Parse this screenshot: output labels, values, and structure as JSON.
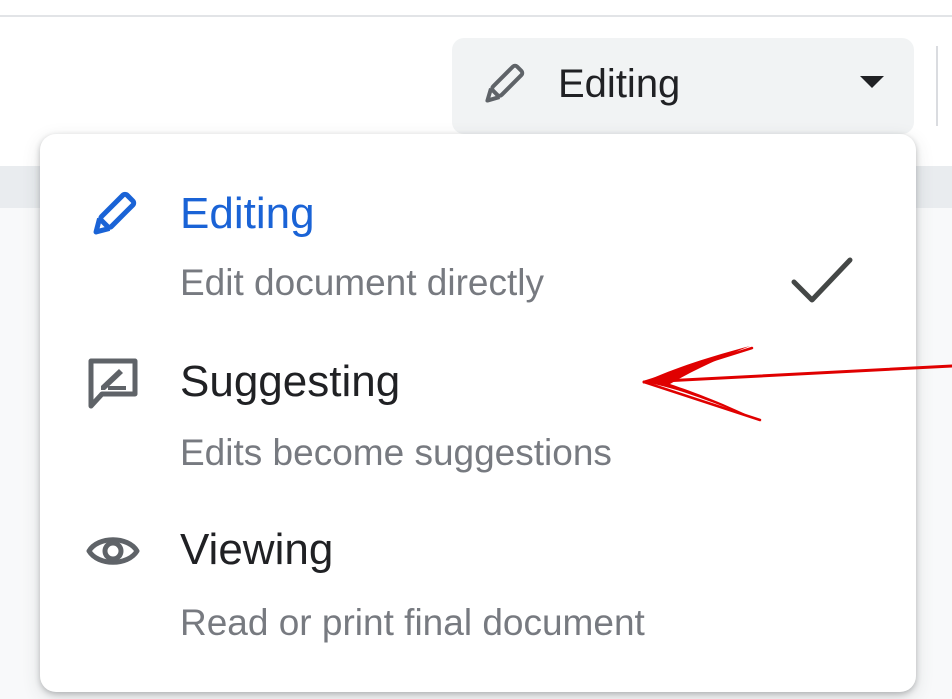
{
  "toolbar": {
    "mode_button": {
      "label": "Editing",
      "icon": "pencil-icon",
      "caret_icon": "caret-down-icon"
    }
  },
  "mode_menu": {
    "items": [
      {
        "title": "Editing",
        "description": "Edit document directly",
        "icon": "pencil-icon",
        "selected": true
      },
      {
        "title": "Suggesting",
        "description": "Edits become suggestions",
        "icon": "suggest-edit-icon",
        "selected": false
      },
      {
        "title": "Viewing",
        "description": "Read or print final document",
        "icon": "eye-icon",
        "selected": false
      }
    ],
    "check_icon": "checkmark-icon"
  },
  "annotation": {
    "type": "red-arrow",
    "color": "#e00000",
    "points_to": "Suggesting"
  },
  "colors": {
    "active_blue": "#1a63d6",
    "text_dark": "#202124",
    "text_muted": "#777a80",
    "icon_gray": "#5f6368",
    "annotation_red": "#e00000"
  }
}
